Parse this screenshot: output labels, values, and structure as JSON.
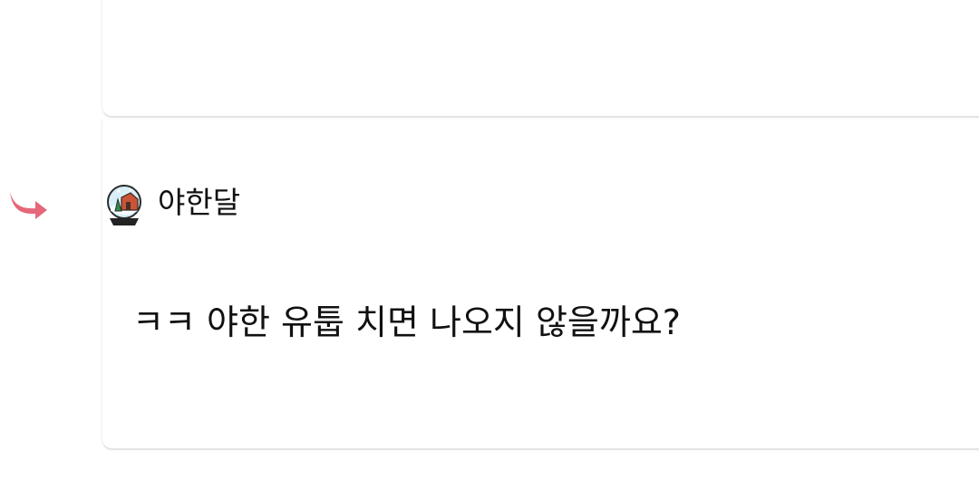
{
  "comment": {
    "author": "야한달",
    "text": "ㅋㅋ 야한 유툽 치면 나오지 않을까요?"
  },
  "icons": {
    "reply": "reply-arrow-icon",
    "avatar": "snow-globe-icon"
  },
  "colors": {
    "reply_arrow": "#e5677a",
    "divider": "#e4e4e4",
    "text": "#111111"
  }
}
